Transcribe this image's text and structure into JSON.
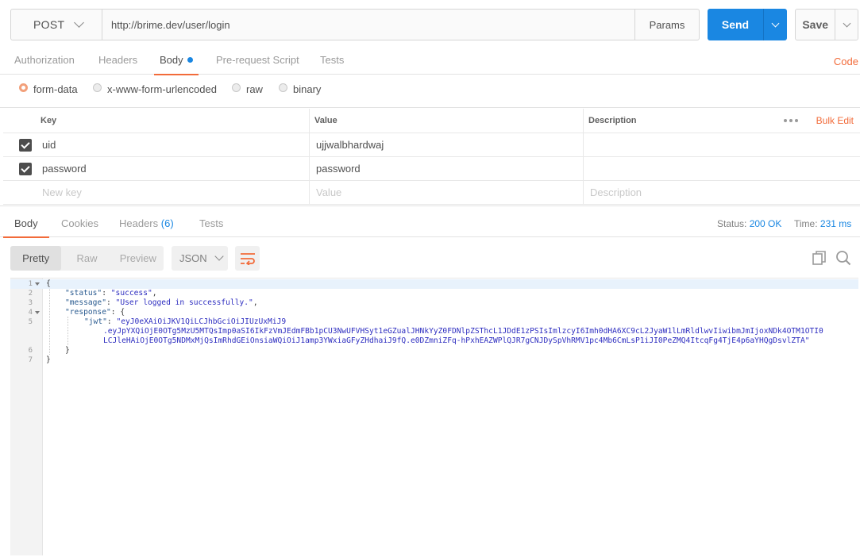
{
  "request": {
    "method": "POST",
    "url": "http://brime.dev/user/login",
    "params_label": "Params",
    "send_label": "Send",
    "save_label": "Save"
  },
  "request_tabs": [
    {
      "label": "Authorization",
      "active": false
    },
    {
      "label": "Headers",
      "active": false
    },
    {
      "label": "Body",
      "active": true
    },
    {
      "label": "Pre-request Script",
      "active": false
    },
    {
      "label": "Tests",
      "active": false
    }
  ],
  "code_link": "Code",
  "body_types": [
    {
      "label": "form-data",
      "selected": true
    },
    {
      "label": "x-www-form-urlencoded",
      "selected": false
    },
    {
      "label": "raw",
      "selected": false
    },
    {
      "label": "binary",
      "selected": false
    }
  ],
  "params_table": {
    "headers": {
      "key": "Key",
      "value": "Value",
      "description": "Description"
    },
    "bulk_edit": "Bulk Edit",
    "rows": [
      {
        "key": "uid",
        "value": "ujjwalbhardwaj",
        "description": "",
        "checked": true
      },
      {
        "key": "password",
        "value": "password",
        "description": "",
        "checked": true
      }
    ],
    "placeholders": {
      "key": "New key",
      "value": "Value",
      "description": "Description"
    }
  },
  "response_tabs": [
    {
      "label": "Body",
      "active": true
    },
    {
      "label": "Cookies",
      "active": false
    },
    {
      "label": "Headers",
      "count": "(6)",
      "active": false
    },
    {
      "label": "Tests",
      "active": false
    }
  ],
  "response_meta": {
    "status_label": "Status:",
    "status_value": "200 OK",
    "time_label": "Time:",
    "time_value": "231 ms"
  },
  "view_modes": [
    {
      "label": "Pretty",
      "active": true
    },
    {
      "label": "Raw",
      "active": false
    },
    {
      "label": "Preview",
      "active": false
    }
  ],
  "format": "JSON",
  "code_lines": [
    {
      "n": "1",
      "fold": true,
      "text": "{"
    },
    {
      "n": "2",
      "fold": false,
      "key": "\"status\"",
      "sep": ": ",
      "str": "\"success\"",
      "tail": ","
    },
    {
      "n": "3",
      "fold": false,
      "key": "\"message\"",
      "sep": ": ",
      "str": "\"User logged in successfully.\"",
      "tail": ","
    },
    {
      "n": "4",
      "fold": true,
      "key": "\"response\"",
      "sep": ": ",
      "tail": "{"
    },
    {
      "n": "5",
      "fold": false,
      "key": "\"jwt\"",
      "sep": ": ",
      "str": "\"eyJ0eXAiOiJKV1QiLCJhbGciOiJIUzUxMiJ9"
    },
    {
      "n": "",
      "fold": false,
      "str": ".eyJpYXQiOjE0OTg5MzU5MTQsImp0aSI6IkFzVmJEdmFBb1pCU3NwUFVHSyt1eGZualJHNkYyZ0FDNlpZSThcL1JDdE1zPSIsImlzcyI6Imh0dHA6XC9cL2JyaW1lLmRldlwvIiwibmJmIjoxNDk4OTM1OTI0"
    },
    {
      "n": "",
      "fold": false,
      "str": "LCJleHAiOjE0OTg5NDMxMjQsImRhdGEiOnsiaWQiOiJ1amp3YWxiaGFyZHdhaiJ9fQ.e0DZmniZFq-hPxhEAZWPlQJR7gCNJDySpVhRMV1pc4Mb6CmLsP1iJI0PeZMQ4ItcqFg4TjE4p6aYHQgDsvlZTA\""
    },
    {
      "n": "6",
      "fold": false,
      "text": "}"
    },
    {
      "n": "7",
      "fold": false,
      "text": "}"
    }
  ]
}
